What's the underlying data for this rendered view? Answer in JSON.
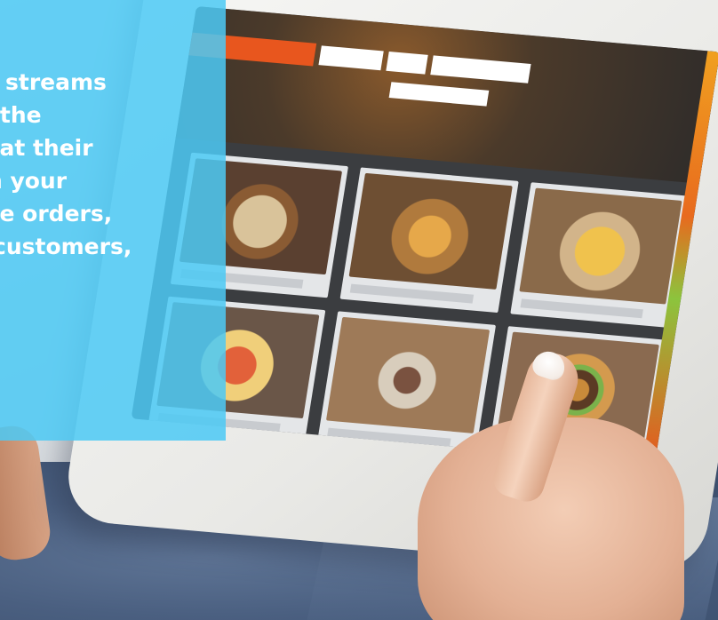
{
  "overlay": {
    "lines": [
      "streams",
      "rs the",
      "ne at their",
      "en your",
      "ore orders,",
      "customers,"
    ]
  },
  "colors": {
    "overlay_panel": "#4DC9F5",
    "nav_accent": "#E8561E"
  },
  "icons": {
    "food_items": [
      "wrap-photo",
      "potato-wedges-photo",
      "french-fries-photo",
      "pizza-photo",
      "sliced-meat-photo",
      "burger-photo"
    ]
  }
}
